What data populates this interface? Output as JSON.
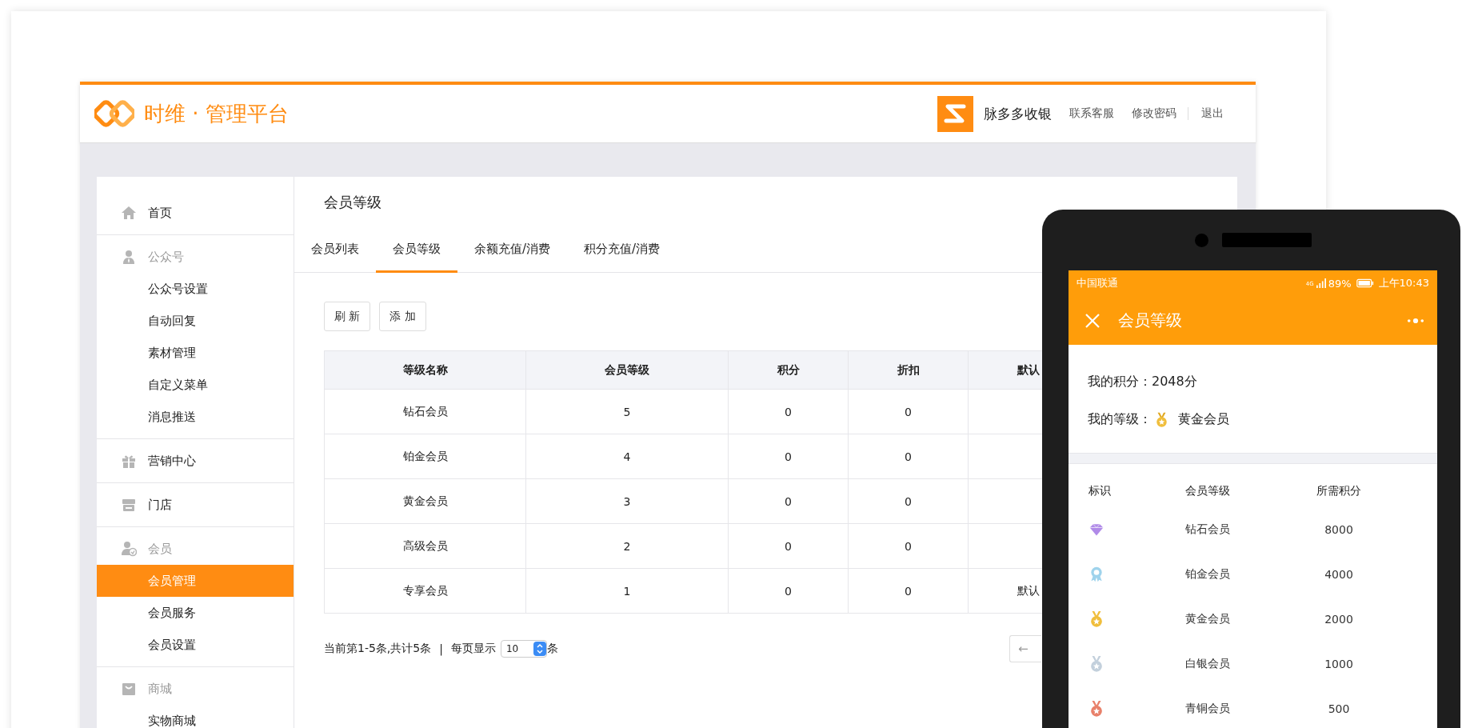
{
  "header": {
    "title": "时维 · 管理平台",
    "account": "脉多多收银",
    "links": [
      "联系客服",
      "修改密码",
      "退出"
    ]
  },
  "sidebar": [
    {
      "kind": "link",
      "label": "首页",
      "selected": false
    },
    {
      "kind": "group",
      "label": "公众号",
      "children": [
        {
          "label": "公众号设置",
          "selected": false
        },
        {
          "label": "自动回复",
          "selected": false
        },
        {
          "label": "素材管理",
          "selected": false
        },
        {
          "label": "自定义菜单",
          "selected": false
        },
        {
          "label": "消息推送",
          "selected": false
        }
      ]
    },
    {
      "kind": "link",
      "label": "营销中心",
      "selected": false
    },
    {
      "kind": "link",
      "label": "门店",
      "selected": false
    },
    {
      "kind": "group",
      "label": "会员",
      "children": [
        {
          "label": "会员管理",
          "selected": true
        },
        {
          "label": "会员服务",
          "selected": false
        },
        {
          "label": "会员设置",
          "selected": false
        }
      ]
    },
    {
      "kind": "group",
      "label": "商城",
      "children": [
        {
          "label": "实物商城",
          "selected": false
        }
      ]
    }
  ],
  "page_title": "会员等级",
  "tabs": [
    {
      "label": "会员列表",
      "selected": false
    },
    {
      "label": "会员等级",
      "selected": true
    },
    {
      "label": "余额充值/消费",
      "selected": false
    },
    {
      "label": "积分充值/消费",
      "selected": false
    }
  ],
  "buttons": [
    "刷 新",
    "添 加"
  ],
  "table": {
    "columns": [
      "等级名称",
      "会员等级",
      "积分",
      "折扣",
      "默认"
    ],
    "rows": [
      {
        "name": "钻石会员",
        "level": "5",
        "points": "0",
        "discount": "0"
      },
      {
        "name": "铂金会员",
        "level": "4",
        "points": "0",
        "discount": "0"
      },
      {
        "name": "黄金会员",
        "level": "3",
        "points": "0",
        "discount": "0"
      },
      {
        "name": "高级会员",
        "level": "2",
        "points": "0",
        "discount": "0"
      },
      {
        "name": "专享会员",
        "level": "1",
        "points": "0",
        "discount": "0",
        "default": "默认"
      }
    ]
  },
  "pagination": {
    "summary": "当前第1-5条,共计5条",
    "separator": "|",
    "per_page_label": "每页显示",
    "per_page": "10",
    "unit": "条",
    "prev": "←"
  },
  "phone": {
    "carrier": "中国联通",
    "network": "4G",
    "battery": "89%",
    "time": "上午10:43",
    "title": "会员等级",
    "points_label": "我的积分：",
    "points": "2048分",
    "level_label": "我的等级：",
    "level": "黄金会员",
    "columns": [
      "标识",
      "会员等级",
      "所需积分"
    ],
    "tiers": [
      {
        "kind": "diamond",
        "color": "#b08ae8",
        "name": "钻石会员",
        "points": "8000"
      },
      {
        "kind": "rosette",
        "color": "#9fd3ec",
        "name": "铂金会员",
        "points": "4000"
      },
      {
        "kind": "medal",
        "color": "#f0be3c",
        "name": "黄金会员",
        "points": "2000"
      },
      {
        "kind": "medal",
        "color": "#c3d0dc",
        "name": "白银会员",
        "points": "1000"
      },
      {
        "kind": "medal",
        "color": "#e8806a",
        "name": "青铜会员",
        "points": "500"
      }
    ]
  }
}
